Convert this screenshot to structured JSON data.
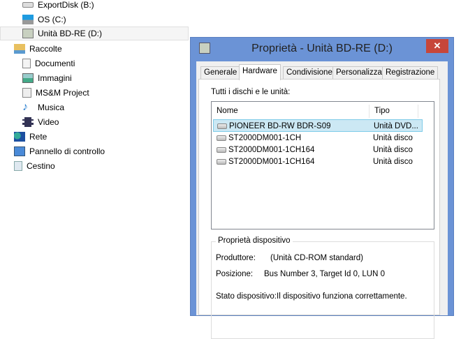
{
  "nav": {
    "items": [
      {
        "label": "ExportDisk (B:)",
        "icon": "drive-icon"
      },
      {
        "label": "OS (C:)",
        "icon": "windows-drive-icon"
      },
      {
        "label": "Unità BD-RE (D:)",
        "icon": "bd-drive-icon"
      },
      {
        "label": "Raccolte",
        "icon": "libraries-icon"
      },
      {
        "label": "Documenti",
        "icon": "documents-icon"
      },
      {
        "label": "Immagini",
        "icon": "pictures-icon"
      },
      {
        "label": "MS&M Project",
        "icon": "project-icon"
      },
      {
        "label": "Musica",
        "icon": "music-icon"
      },
      {
        "label": "Video",
        "icon": "video-icon"
      },
      {
        "label": "Rete",
        "icon": "network-icon"
      },
      {
        "label": "Pannello di controllo",
        "icon": "control-panel-icon"
      },
      {
        "label": "Cestino",
        "icon": "recycle-bin-icon"
      }
    ]
  },
  "dialog": {
    "title": "Proprietà - Unità BD-RE (D:)",
    "close": "✕",
    "tabs": [
      "Generale",
      "Hardware",
      "Condivisione",
      "Personalizza",
      "Registrazione"
    ],
    "list_label": "Tutti i dischi e le unità:",
    "columns": [
      "Nome",
      "Tipo"
    ],
    "rows": [
      {
        "name": "PIONEER BD-RW   BDR-S09",
        "type": "Unità DVD..."
      },
      {
        "name": "ST2000DM001-1CH",
        "type": "Unità disco"
      },
      {
        "name": "ST2000DM001-1CH164",
        "type": "Unità disco"
      },
      {
        "name": "ST2000DM001-1CH164",
        "type": "Unità disco"
      }
    ],
    "group_title": "Proprietà dispositivo",
    "manufacturer_label": "Produttore:",
    "manufacturer": "(Unità CD-ROM standard)",
    "location_label": "Posizione:",
    "location": "Bus Number 3, Target Id 0, LUN 0",
    "status_label": "Stato dispositivo:",
    "status": "Il dispositivo funziona correttamente."
  }
}
